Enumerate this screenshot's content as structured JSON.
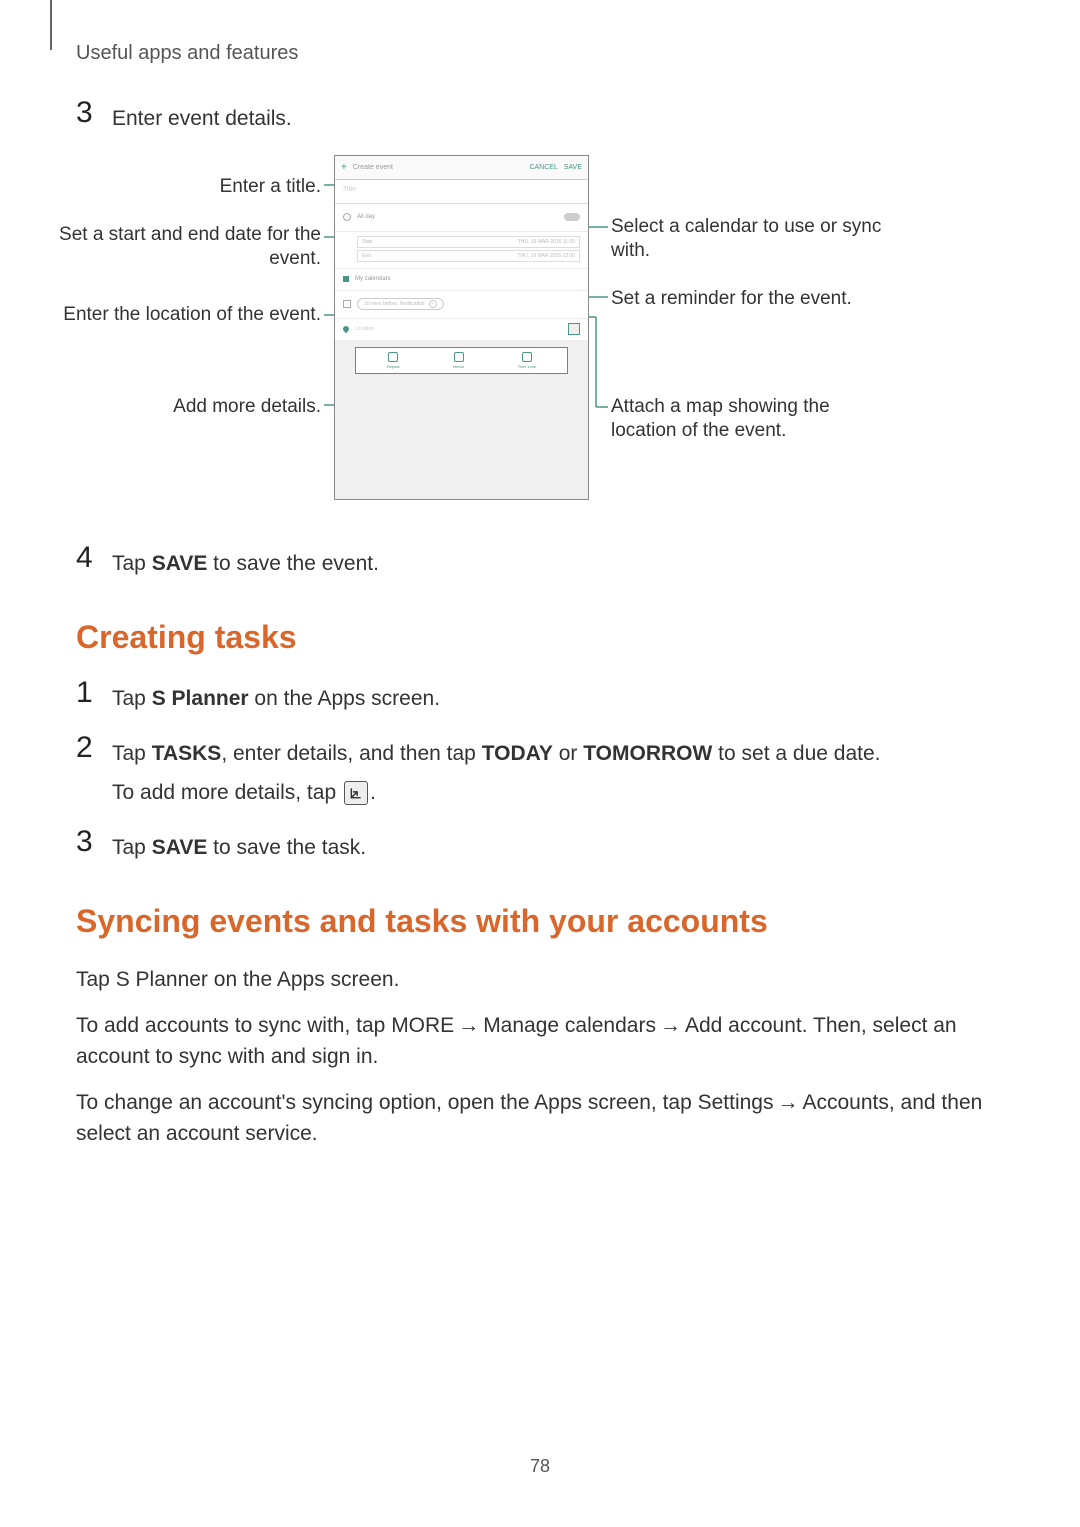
{
  "header": "Useful apps and features",
  "page_number": "78",
  "step3": {
    "num": "3",
    "text": "Enter event details."
  },
  "callouts": {
    "title": "Enter a title.",
    "dates": "Set a start and end date for the event.",
    "location": "Enter the location of the event.",
    "more": "Add more details.",
    "calendar": "Select a calendar to use or sync with.",
    "reminder": "Set a reminder for the event.",
    "map": "Attach a map showing the location of the event."
  },
  "mock": {
    "header_action": "Create event",
    "header_right1": "CANCEL",
    "header_right2": "SAVE",
    "title_placeholder": "Title",
    "allday": "All day",
    "start_label": "Start",
    "start_date": "THU, 19 MAR 2015   11:00",
    "end_label": "End",
    "end_date": "THU, 19 MAR 2015   12:00",
    "calendar": "My calendars",
    "reminder_text": "10 mins before, Notification",
    "location_text": "Location",
    "btn_repeat": "Repeat",
    "btn_memo": "Memo",
    "btn_timezone": "Time zone"
  },
  "step4": {
    "num": "4",
    "prefix": "Tap ",
    "bold": "SAVE",
    "suffix": " to save the event."
  },
  "section1": {
    "heading": "Creating tasks",
    "s1": {
      "num": "1",
      "prefix": "Tap ",
      "bold": "S Planner",
      "suffix": " on the Apps screen."
    },
    "s2": {
      "num": "2",
      "t1": "Tap ",
      "b1": "TASKS",
      "t2": ", enter details, and then tap ",
      "b2": "TODAY",
      "t3": " or ",
      "b3": "TOMORROW",
      "t4": " to set a due date.",
      "sub": "To add more details, tap ",
      "sub_end": "."
    },
    "s3": {
      "num": "3",
      "prefix": "Tap ",
      "bold": "SAVE",
      "suffix": " to save the task."
    }
  },
  "section2": {
    "heading": "Syncing events and tasks with your accounts",
    "p1": {
      "t1": "Tap ",
      "b1": "S Planner",
      "t2": " on the Apps screen."
    },
    "p2": {
      "t1": "To add accounts to sync with, tap ",
      "b1": "MORE",
      "arr1": " → ",
      "b2": "Manage calendars",
      "arr2": " → ",
      "b3": "Add account",
      "t2": ". Then, select an account to sync with and sign in."
    },
    "p3": {
      "t1": "To change an account's syncing option, open the Apps screen, tap ",
      "b1": "Settings",
      "arr1": " → ",
      "b2": "Accounts",
      "t2": ", and then select an account service."
    }
  }
}
